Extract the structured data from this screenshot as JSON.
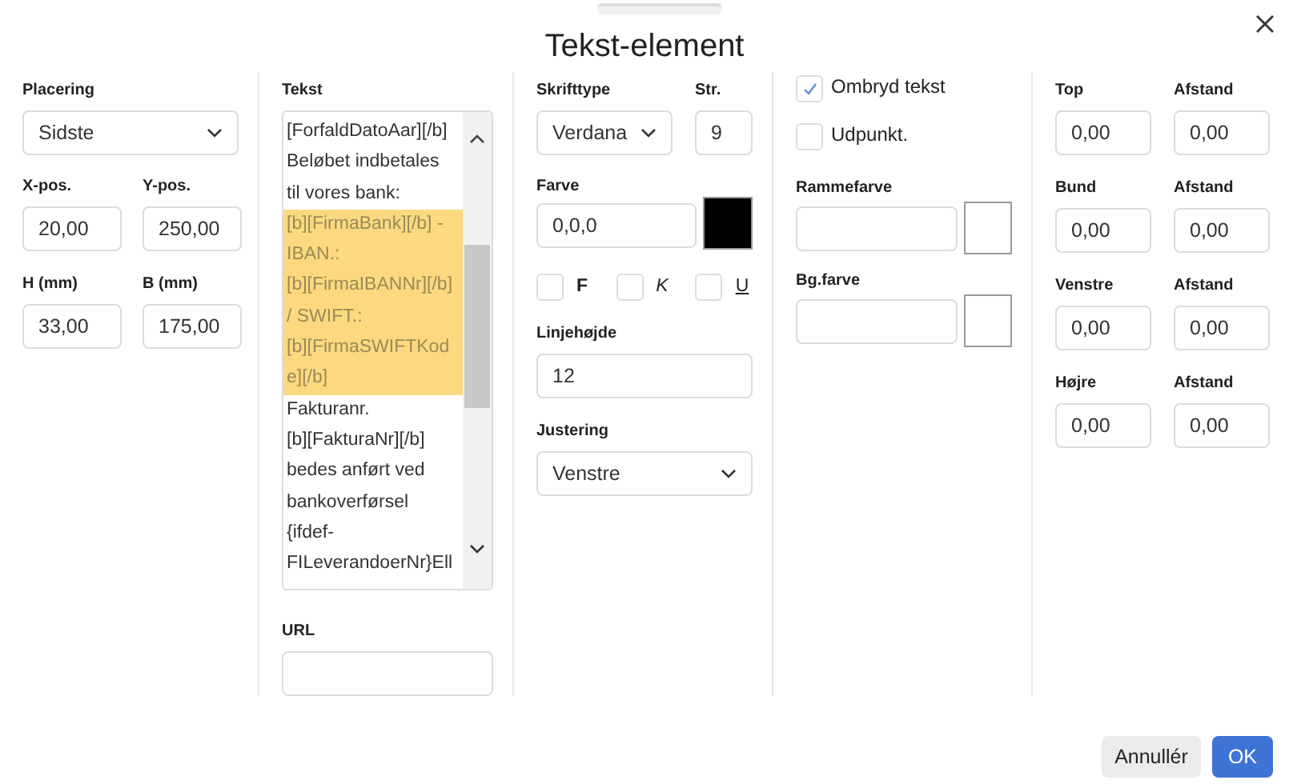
{
  "dialog": {
    "title": "Tekst-element"
  },
  "placement": {
    "label": "Placering",
    "value": "Sidste"
  },
  "position": [
    {
      "label": "X-pos.",
      "value": "20,00"
    },
    {
      "label": "Y-pos.",
      "value": "250,00"
    },
    {
      "label": "H (mm)",
      "value": "33,00"
    },
    {
      "label": "B (mm)",
      "value": "175,00"
    }
  ],
  "text": {
    "label": "Tekst",
    "lines": [
      {
        "text": "[ForfaldDatoAar][/b]",
        "selected": false
      },
      {
        "text": "Beløbet indbetales",
        "selected": false
      },
      {
        "text": "til vores bank:",
        "selected": false
      },
      {
        "text": "[b][FirmaBank][/b] -",
        "selected": true
      },
      {
        "text": "IBAN.:",
        "selected": true
      },
      {
        "text": "[b][FirmaIBANNr][/b]",
        "selected": true
      },
      {
        "text": "/ SWIFT.:",
        "selected": true
      },
      {
        "text": "[b][FirmaSWIFTKod",
        "selected": true
      },
      {
        "text": "e][/b]",
        "selected": true
      },
      {
        "text": "Fakturanr.",
        "selected": false
      },
      {
        "text": "[b][FakturaNr][/b]",
        "selected": false
      },
      {
        "text": "bedes anført ved",
        "selected": false
      },
      {
        "text": "bankoverførsel",
        "selected": false
      },
      {
        "text": "{ifdef-",
        "selected": false
      },
      {
        "text": "FILeverandoerNr}Ell",
        "selected": false
      }
    ]
  },
  "url": {
    "label": "URL"
  },
  "font": {
    "label": "Skrifttype",
    "value": "Verdana"
  },
  "size": {
    "label": "Str.",
    "value": "9"
  },
  "color": {
    "label": "Farve",
    "value": "0,0,0",
    "color": "#000000"
  },
  "styles": [
    {
      "label": "F",
      "kind": "bold",
      "checked": false
    },
    {
      "label": "K",
      "kind": "italic",
      "checked": false
    },
    {
      "label": "U",
      "kind": "underline",
      "checked": false
    }
  ],
  "line_height": {
    "label": "Linjehøjde",
    "value": "12"
  },
  "alignment": {
    "label": "Justering",
    "value": "Venstre"
  },
  "options": [
    {
      "label": "Ombryd tekst",
      "checked": true
    },
    {
      "label": "Udpunkt.",
      "checked": false
    }
  ],
  "border_color": {
    "label": "Rammefarve",
    "color": "#ffffff"
  },
  "background_color": {
    "label": "Bg.farve",
    "color": "#ffffff"
  },
  "margins": [
    {
      "label": "Top",
      "value": "0,00",
      "spacing_label": "Afstand",
      "spacing_value": "0,00"
    },
    {
      "label": "Bund",
      "value": "0,00",
      "spacing_label": "Afstand",
      "spacing_value": "0,00"
    },
    {
      "label": "Venstre",
      "value": "0,00",
      "spacing_label": "Afstand",
      "spacing_value": "0,00"
    },
    {
      "label": "Højre",
      "value": "0,00",
      "spacing_label": "Afstand",
      "spacing_value": "0,00"
    }
  ],
  "buttons": [
    {
      "label": "Annullér",
      "kind": "secondary"
    },
    {
      "label": "OK",
      "kind": "primary"
    }
  ]
}
